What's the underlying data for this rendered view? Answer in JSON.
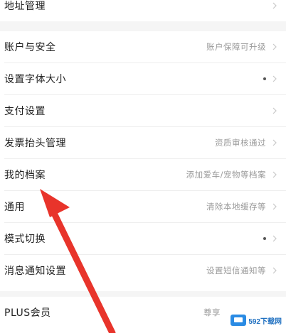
{
  "settings": {
    "rows": [
      {
        "label": "地址管理",
        "value": ""
      },
      {
        "label": "账户与安全",
        "value": "账户保障可升级"
      },
      {
        "label": "设置字体大小",
        "value": ""
      },
      {
        "label": "支付设置",
        "value": ""
      },
      {
        "label": "发票抬头管理",
        "value": "资质审核通过"
      },
      {
        "label": "我的档案",
        "value": "添加爱车/宠物等档案"
      },
      {
        "label": "通用",
        "value": "清除本地缓存等"
      },
      {
        "label": "模式切换",
        "value": ""
      },
      {
        "label": "消息通知设置",
        "value": "设置短信通知等"
      },
      {
        "label": "PLUS会员",
        "value": "尊享"
      }
    ]
  },
  "annotation": {
    "arrow_color": "#e8342b",
    "points_to": "我的档案"
  },
  "watermark": {
    "text": "592下载网"
  }
}
